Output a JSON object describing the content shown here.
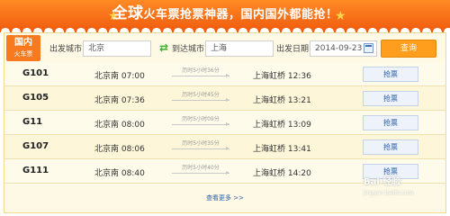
{
  "banner": {
    "title_emphasis": "全球",
    "title_rest": "火车票抢票神器，国内国外都能抢！"
  },
  "tag": {
    "line1": "国内",
    "line2": "火车票"
  },
  "search": {
    "from_label": "出发城市",
    "from_value": "北京",
    "to_label": "到达城市",
    "to_value": "上海",
    "date_label": "出发日期",
    "date_value": "2014-09-23",
    "query_label": "查询"
  },
  "trains": [
    {
      "number": "G101",
      "depart": "北京南 07:00",
      "duration": "历时5小时36分",
      "arrive": "上海虹桥 12:36",
      "action": "抢票"
    },
    {
      "number": "G105",
      "depart": "北京南 07:36",
      "duration": "历时5小时45分",
      "arrive": "上海虹桥 13:21",
      "action": "抢票"
    },
    {
      "number": "G11",
      "depart": "北京南 08:00",
      "duration": "历时5小时09分",
      "arrive": "上海虹桥 13:09",
      "action": "抢票"
    },
    {
      "number": "G107",
      "depart": "北京南 08:06",
      "duration": "历时5小时35分",
      "arrive": "上海虹桥 13:41",
      "action": "抢票"
    },
    {
      "number": "G111",
      "depart": "北京南 08:40",
      "duration": "历时5小时40分",
      "arrive": "上海虹桥 14:20",
      "action": "抢票"
    }
  ],
  "more_link": "查看更多 >>",
  "watermark": {
    "line1": "Bai 经验",
    "line2": "jingyan.baidu.com"
  },
  "colors": {
    "banner": "#f26a14",
    "accent": "#ff9d1c",
    "link": "#2a5fa8"
  }
}
